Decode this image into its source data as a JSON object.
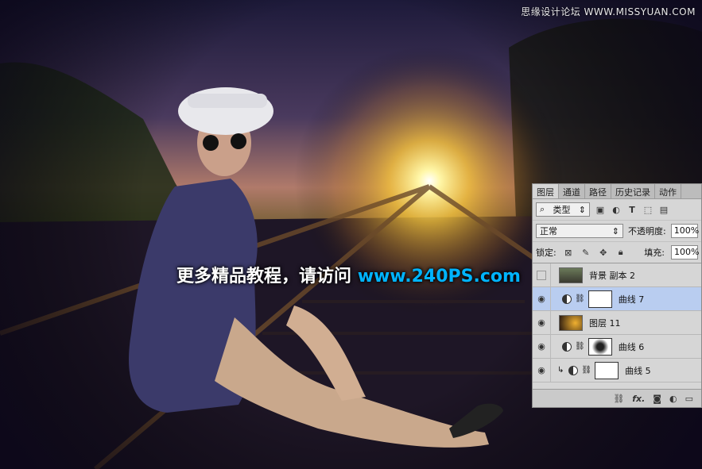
{
  "watermark": "思缘设计论坛 WWW.MISSYUAN.COM",
  "overlay": {
    "text": "更多精品教程，请访问",
    "url": "www.240PS.com"
  },
  "panel": {
    "tabs": [
      "图层",
      "通道",
      "路径",
      "历史记录",
      "动作"
    ],
    "filter_kind": "类型",
    "blend_mode": "正常",
    "opacity_label": "不透明度:",
    "opacity_value": "100%",
    "lock_label": "锁定:",
    "fill_label": "填充:",
    "fill_value": "100%",
    "layers": [
      {
        "name": "背景 副本 2",
        "visible": false,
        "selected": false,
        "type": "photo"
      },
      {
        "name": "曲线 7",
        "visible": true,
        "selected": true,
        "type": "curves"
      },
      {
        "name": "图层 11",
        "visible": true,
        "selected": false,
        "type": "image"
      },
      {
        "name": "曲线 6",
        "visible": true,
        "selected": false,
        "type": "curves"
      },
      {
        "name": "曲线 5",
        "visible": true,
        "selected": false,
        "type": "curves"
      }
    ]
  }
}
